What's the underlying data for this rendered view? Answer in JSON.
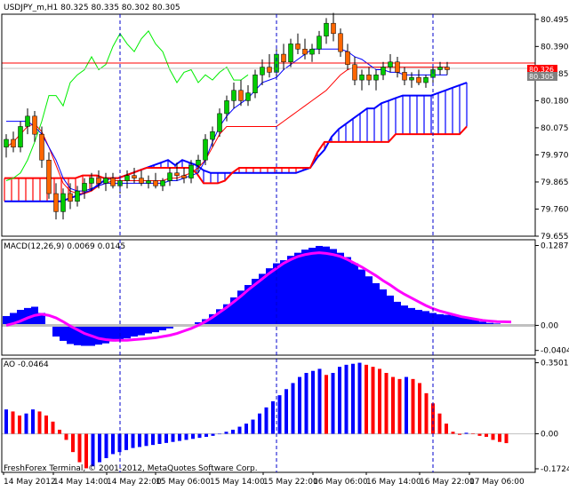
{
  "header": {
    "symbol_line": "USDJPY_m,H1  80.325 80.335 80.302 80.305",
    "price_badge": "80.305",
    "price_badge_upper": "80.326"
  },
  "footer": {
    "copyright": "FreshForex Terminal, © 2001-2012, MetaQuotes Software Corp."
  },
  "colors": {
    "bull": "#00cc00",
    "bear": "#ff6600",
    "tenkan": "#ff0000",
    "kijun": "#0000ff",
    "chikou": "#00ee00",
    "span_a": "#0000ff",
    "span_b": "#ff0000",
    "macd_hist": "#0000ff",
    "macd_signal": "#ff00ff",
    "ao_up": "#0000ff",
    "ao_down": "#ff0000",
    "grid": "#0000cc"
  },
  "chart_data": [
    {
      "type": "candlestick",
      "name": "USDJPY_m,H1 Ichimoku",
      "y_ticks": [
        "80.495",
        "80.390",
        "80.285",
        "80.180",
        "80.075",
        "79.970",
        "79.865",
        "79.760",
        "79.655"
      ],
      "x_ticks": [
        "14 May 2012",
        "14 May 14:00",
        "14 May 22:00",
        "15 May 06:00",
        "15 May 14:00",
        "15 May 22:00",
        "16 May 06:00",
        "16 May 14:00",
        "16 May 22:00",
        "17 May 06:00"
      ],
      "ylim": [
        79.655,
        80.515
      ],
      "last_price": 80.305,
      "upper_level": 80.326,
      "candles": [
        [
          80.0,
          80.05,
          79.96,
          80.03
        ],
        [
          80.03,
          80.06,
          79.98,
          80.0
        ],
        [
          80.0,
          80.1,
          79.98,
          80.08
        ],
        [
          80.08,
          80.15,
          80.05,
          80.12
        ],
        [
          80.12,
          80.14,
          80.02,
          80.05
        ],
        [
          80.05,
          80.08,
          79.92,
          79.95
        ],
        [
          79.95,
          79.98,
          79.8,
          79.82
        ],
        [
          79.82,
          79.86,
          79.72,
          79.75
        ],
        [
          79.75,
          79.84,
          79.72,
          79.82
        ],
        [
          79.82,
          79.86,
          79.76,
          79.79
        ],
        [
          79.79,
          79.85,
          79.77,
          79.83
        ],
        [
          79.83,
          79.88,
          79.8,
          79.86
        ],
        [
          79.86,
          79.9,
          79.83,
          79.88
        ],
        [
          79.88,
          79.91,
          79.84,
          79.86
        ],
        [
          79.86,
          79.9,
          79.83,
          79.88
        ],
        [
          79.88,
          79.9,
          79.84,
          79.85
        ],
        [
          79.85,
          79.89,
          79.82,
          79.87
        ],
        [
          79.87,
          79.91,
          79.84,
          79.89
        ],
        [
          79.89,
          79.92,
          79.86,
          79.88
        ],
        [
          79.88,
          79.91,
          79.85,
          79.86
        ],
        [
          79.86,
          79.89,
          79.84,
          79.87
        ],
        [
          79.87,
          79.9,
          79.84,
          79.85
        ],
        [
          79.85,
          79.88,
          79.83,
          79.87
        ],
        [
          79.87,
          79.92,
          79.85,
          79.9
        ],
        [
          79.9,
          79.94,
          79.87,
          79.89
        ],
        [
          79.89,
          79.92,
          79.86,
          79.88
        ],
        [
          79.88,
          79.95,
          79.86,
          79.93
        ],
        [
          79.93,
          79.97,
          79.9,
          79.95
        ],
        [
          79.95,
          80.05,
          79.93,
          80.03
        ],
        [
          80.03,
          80.08,
          80.0,
          80.06
        ],
        [
          80.06,
          80.15,
          80.04,
          80.13
        ],
        [
          80.13,
          80.2,
          80.1,
          80.18
        ],
        [
          80.18,
          80.25,
          80.15,
          80.22
        ],
        [
          80.22,
          80.26,
          80.16,
          80.18
        ],
        [
          80.18,
          80.24,
          80.16,
          80.21
        ],
        [
          80.21,
          80.3,
          80.19,
          80.28
        ],
        [
          80.28,
          80.34,
          80.24,
          80.31
        ],
        [
          80.31,
          80.36,
          80.27,
          80.29
        ],
        [
          80.29,
          80.38,
          80.27,
          80.36
        ],
        [
          80.36,
          80.4,
          80.3,
          80.33
        ],
        [
          80.33,
          80.42,
          80.31,
          80.4
        ],
        [
          80.4,
          80.44,
          80.36,
          80.38
        ],
        [
          80.38,
          80.42,
          80.34,
          80.36
        ],
        [
          80.36,
          80.4,
          80.33,
          80.38
        ],
        [
          80.38,
          80.45,
          80.36,
          80.43
        ],
        [
          80.43,
          80.5,
          80.4,
          80.48
        ],
        [
          80.48,
          80.52,
          80.41,
          80.44
        ],
        [
          80.44,
          80.46,
          80.35,
          80.37
        ],
        [
          80.37,
          80.4,
          80.3,
          80.32
        ],
        [
          80.32,
          80.35,
          80.24,
          80.26
        ],
        [
          80.26,
          80.3,
          80.22,
          80.28
        ],
        [
          80.28,
          80.31,
          80.24,
          80.26
        ],
        [
          80.26,
          80.3,
          80.22,
          80.28
        ],
        [
          80.28,
          80.33,
          80.26,
          80.31
        ],
        [
          80.31,
          80.36,
          80.29,
          80.33
        ],
        [
          80.33,
          80.35,
          80.27,
          80.29
        ],
        [
          80.29,
          80.31,
          80.24,
          80.26
        ],
        [
          80.26,
          80.29,
          80.23,
          80.27
        ],
        [
          80.27,
          80.3,
          80.24,
          80.25
        ],
        [
          80.25,
          80.28,
          80.23,
          80.27
        ],
        [
          80.27,
          80.32,
          80.25,
          80.3
        ],
        [
          80.3,
          80.33,
          80.28,
          80.31
        ],
        [
          80.31,
          80.33,
          80.28,
          80.3
        ]
      ],
      "lines": {
        "tenkan": [
          80.0,
          80.02,
          80.05,
          80.08,
          80.09,
          80.06,
          80.0,
          79.93,
          79.86,
          79.83,
          79.82,
          79.82,
          79.83,
          79.85,
          79.86,
          79.87,
          79.87,
          79.87,
          79.87,
          79.87,
          79.87,
          79.87,
          79.87,
          79.88,
          79.88,
          79.89,
          79.9,
          79.92,
          79.95,
          80.0,
          80.05,
          80.08,
          80.08,
          80.08,
          80.08,
          80.08,
          80.08,
          80.08,
          80.08,
          80.1,
          80.12,
          80.14,
          80.16,
          80.18,
          80.2,
          80.22,
          80.25,
          80.28,
          80.3,
          80.31,
          80.31,
          80.31,
          80.31,
          80.31,
          80.31,
          80.31,
          80.31,
          80.31,
          80.31,
          80.31,
          80.31,
          80.31,
          80.31
        ],
        "kijun": [
          80.1,
          80.1,
          80.1,
          80.1,
          80.08,
          80.05,
          80.0,
          79.95,
          79.88,
          79.84,
          79.83,
          79.83,
          79.84,
          79.85,
          79.86,
          79.86,
          79.86,
          79.86,
          79.86,
          79.86,
          79.86,
          79.86,
          79.86,
          79.87,
          79.87,
          79.88,
          79.89,
          79.9,
          79.95,
          80.02,
          80.08,
          80.12,
          80.15,
          80.17,
          80.19,
          80.22,
          80.25,
          80.26,
          80.27,
          80.3,
          80.32,
          80.34,
          80.36,
          80.38,
          80.38,
          80.38,
          80.38,
          80.38,
          80.37,
          80.35,
          80.34,
          80.32,
          80.3,
          80.3,
          80.29,
          80.29,
          80.28,
          80.28,
          80.28,
          80.28,
          80.28,
          80.28,
          80.28
        ],
        "chikou": [
          79.87,
          79.88,
          79.9,
          79.95,
          80.02,
          80.1,
          80.2,
          80.2,
          80.16,
          80.25,
          80.28,
          80.3,
          80.35,
          80.3,
          80.32,
          80.39,
          80.44,
          80.4,
          80.37,
          80.42,
          80.45,
          80.4,
          80.37,
          80.3,
          80.25,
          80.29,
          80.3,
          80.25,
          80.28,
          80.26,
          80.29,
          80.31,
          80.26,
          80.26,
          80.28
        ]
      },
      "cloud": {
        "span_a": [
          79.79,
          79.79,
          79.79,
          79.79,
          79.79,
          79.79,
          79.79,
          79.79,
          79.79,
          79.8,
          79.81,
          79.82,
          79.83,
          79.85,
          79.87,
          79.88,
          79.88,
          79.89,
          79.9,
          79.91,
          79.92,
          79.93,
          79.94,
          79.95,
          79.93,
          79.95,
          79.94,
          79.93,
          79.91,
          79.9,
          79.9,
          79.9,
          79.9,
          79.9,
          79.9,
          79.9,
          79.9,
          79.9,
          79.9,
          79.9,
          79.9,
          79.9,
          79.91,
          79.92,
          79.96,
          79.99,
          80.04,
          80.07,
          80.09,
          80.11,
          80.13,
          80.15,
          80.15,
          80.17,
          80.18,
          80.19,
          80.2,
          80.2,
          80.2,
          80.2,
          80.2,
          80.21,
          80.22,
          80.23,
          80.24,
          80.25
        ],
        "span_b": [
          79.88,
          79.88,
          79.88,
          79.88,
          79.88,
          79.88,
          79.88,
          79.88,
          79.88,
          79.88,
          79.88,
          79.89,
          79.89,
          79.89,
          79.88,
          79.88,
          79.88,
          79.89,
          79.9,
          79.91,
          79.92,
          79.92,
          79.92,
          79.92,
          79.92,
          79.92,
          79.92,
          79.9,
          79.86,
          79.86,
          79.86,
          79.87,
          79.9,
          79.92,
          79.92,
          79.92,
          79.92,
          79.92,
          79.92,
          79.92,
          79.92,
          79.92,
          79.92,
          79.92,
          79.98,
          80.02,
          80.02,
          80.02,
          80.02,
          80.02,
          80.02,
          80.02,
          80.02,
          80.02,
          80.02,
          80.05,
          80.05,
          80.05,
          80.05,
          80.05,
          80.05,
          80.05,
          80.05,
          80.05,
          80.05,
          80.08
        ]
      }
    },
    {
      "type": "bar",
      "name": "MACD(12,26,9)",
      "label": "MACD(12,26,9) 0.0069 0.0145",
      "y_ticks": [
        "0.1287",
        "0.00",
        "-0.0404"
      ],
      "ylim": [
        -0.048,
        0.138
      ],
      "values": [
        0.015,
        0.02,
        0.025,
        0.028,
        0.03,
        0.02,
        0.0,
        -0.018,
        -0.025,
        -0.03,
        -0.032,
        -0.033,
        -0.033,
        -0.031,
        -0.029,
        -0.026,
        -0.024,
        -0.021,
        -0.018,
        -0.016,
        -0.013,
        -0.011,
        -0.008,
        -0.005,
        -0.002,
        0.0,
        0.002,
        0.005,
        0.01,
        0.018,
        0.026,
        0.034,
        0.045,
        0.056,
        0.065,
        0.075,
        0.083,
        0.092,
        0.1,
        0.105,
        0.112,
        0.117,
        0.122,
        0.125,
        0.128,
        0.127,
        0.123,
        0.117,
        0.11,
        0.1,
        0.09,
        0.079,
        0.068,
        0.058,
        0.048,
        0.038,
        0.032,
        0.028,
        0.025,
        0.023,
        0.02,
        0.018,
        0.017,
        0.016,
        0.015,
        0.012,
        0.009,
        0.006,
        0.004,
        0.003,
        0.002,
        0.0015
      ],
      "signal": [
        0.0,
        0.003,
        0.007,
        0.012,
        0.016,
        0.018,
        0.016,
        0.012,
        0.006,
        -0.001,
        -0.007,
        -0.013,
        -0.017,
        -0.021,
        -0.023,
        -0.024,
        -0.024,
        -0.024,
        -0.023,
        -0.022,
        -0.021,
        -0.02,
        -0.018,
        -0.016,
        -0.013,
        -0.009,
        -0.005,
        0.0,
        0.006,
        0.013,
        0.021,
        0.029,
        0.038,
        0.047,
        0.057,
        0.066,
        0.075,
        0.084,
        0.092,
        0.1,
        0.106,
        0.111,
        0.114,
        0.116,
        0.117,
        0.116,
        0.114,
        0.111,
        0.106,
        0.1,
        0.094,
        0.087,
        0.08,
        0.072,
        0.065,
        0.057,
        0.05,
        0.044,
        0.038,
        0.032,
        0.027,
        0.023,
        0.02,
        0.017,
        0.014,
        0.012,
        0.01,
        0.008,
        0.007,
        0.006,
        0.0058,
        0.0055
      ]
    },
    {
      "type": "bar",
      "name": "AO",
      "label": "AO -0.0464",
      "y_ticks": [
        "0.3501",
        "0.00",
        "-0.1724"
      ],
      "ylim": [
        -0.19,
        0.37
      ],
      "values": [
        0.12,
        0.11,
        0.09,
        0.1,
        0.12,
        0.11,
        0.09,
        0.06,
        0.02,
        -0.03,
        -0.09,
        -0.14,
        -0.17,
        -0.16,
        -0.14,
        -0.12,
        -0.1,
        -0.09,
        -0.08,
        -0.07,
        -0.065,
        -0.06,
        -0.055,
        -0.05,
        -0.045,
        -0.04,
        -0.035,
        -0.03,
        -0.025,
        -0.02,
        -0.015,
        -0.01,
        0.0,
        0.01,
        0.02,
        0.035,
        0.05,
        0.07,
        0.1,
        0.13,
        0.16,
        0.19,
        0.22,
        0.25,
        0.28,
        0.3,
        0.31,
        0.32,
        0.29,
        0.3,
        0.33,
        0.34,
        0.345,
        0.35,
        0.34,
        0.33,
        0.32,
        0.3,
        0.28,
        0.27,
        0.28,
        0.27,
        0.25,
        0.2,
        0.15,
        0.1,
        0.05,
        0.01,
        -0.005,
        0.005,
        0.002,
        -0.01,
        -0.015,
        -0.03,
        -0.04,
        -0.046
      ]
    }
  ]
}
